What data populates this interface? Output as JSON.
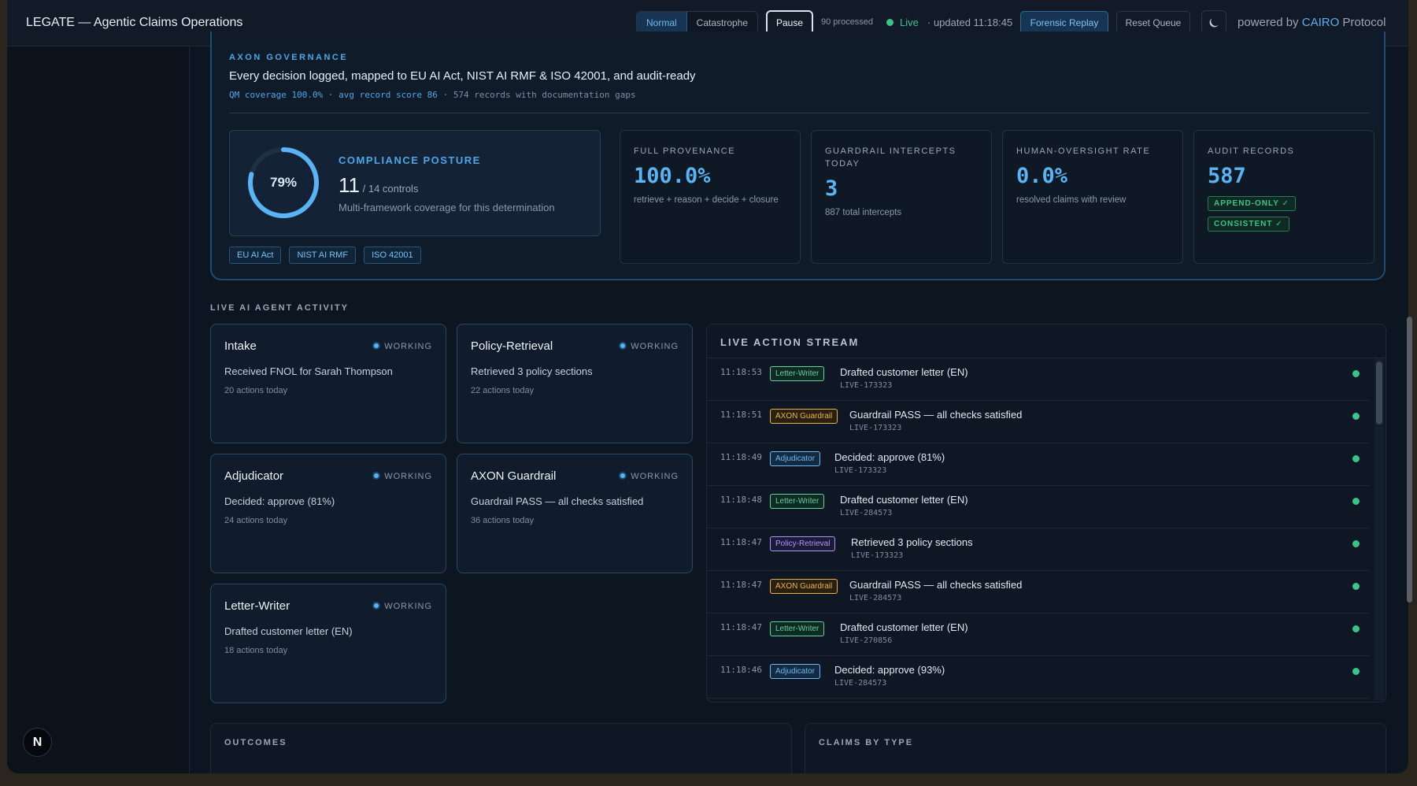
{
  "header": {
    "title": "LEGATE — Agentic Claims Operations",
    "modes": [
      "Normal",
      "Catastrophe"
    ],
    "active_mode": "Normal",
    "pause_label": "Pause",
    "processed": "90 processed",
    "live_label": "Live",
    "updated": "· updated 11:18:45",
    "forensic_label": "Forensic Replay",
    "reset_label": "Reset Queue",
    "powered_prefix": "powered by",
    "powered_brand": "CAIRO",
    "powered_suffix": "Protocol"
  },
  "governance": {
    "eyebrow": "AXON GOVERNANCE",
    "headline": "Every decision logged, mapped to EU AI Act, NIST AI RMF & ISO 42001, and audit-ready",
    "qm_coverage": "QM coverage 100.0%",
    "avg_score": "avg record score 86",
    "gaps": "574 records with documentation gaps",
    "posture": {
      "percent_label": "79%",
      "percent_value": 79,
      "title": "COMPLIANCE POSTURE",
      "controls_met": "11",
      "controls_total": "/ 14 controls",
      "description": "Multi-framework coverage for this determination"
    },
    "frameworks": [
      "EU AI Act",
      "NIST AI RMF",
      "ISO 42001"
    ],
    "metrics": [
      {
        "label": "FULL PROVENANCE",
        "value": "100.0%",
        "sub": "retrieve + reason + decide + closure"
      },
      {
        "label": "GUARDRAIL INTERCEPTS TODAY",
        "value": "3",
        "sub": "887 total intercepts"
      },
      {
        "label": "HUMAN-OVERSIGHT RATE",
        "value": "0.0%",
        "sub": "resolved claims with review"
      },
      {
        "label": "AUDIT RECORDS",
        "value": "587",
        "badges": [
          "APPEND-ONLY ✓",
          "CONSISTENT ✓"
        ]
      }
    ]
  },
  "agents": {
    "section_label": "LIVE AI AGENT ACTIVITY",
    "items": [
      {
        "name": "Intake",
        "status": "WORKING",
        "activity": "Received FNOL for Sarah Thompson",
        "count": "20 actions today"
      },
      {
        "name": "Policy-Retrieval",
        "status": "WORKING",
        "activity": "Retrieved 3 policy sections",
        "count": "22 actions today"
      },
      {
        "name": "Adjudicator",
        "status": "WORKING",
        "activity": "Decided: approve (81%)",
        "count": "24 actions today"
      },
      {
        "name": "AXON Guardrail",
        "status": "WORKING",
        "activity": "Guardrail PASS — all checks satisfied",
        "count": "36 actions today"
      },
      {
        "name": "Letter-Writer",
        "status": "WORKING",
        "activity": "Drafted customer letter (EN)",
        "count": "18 actions today"
      }
    ]
  },
  "stream": {
    "title": "LIVE ACTION STREAM",
    "rows": [
      {
        "time": "11:18:53",
        "agent": "Letter-Writer",
        "message": "Drafted customer letter (EN)",
        "claim": "LIVE-173323"
      },
      {
        "time": "11:18:51",
        "agent": "AXON Guardrail",
        "message": "Guardrail PASS — all checks satisfied",
        "claim": "LIVE-173323"
      },
      {
        "time": "11:18:49",
        "agent": "Adjudicator",
        "message": "Decided: approve (81%)",
        "claim": "LIVE-173323"
      },
      {
        "time": "11:18:48",
        "agent": "Letter-Writer",
        "message": "Drafted customer letter (EN)",
        "claim": "LIVE-284573"
      },
      {
        "time": "11:18:47",
        "agent": "Policy-Retrieval",
        "message": "Retrieved 3 policy sections",
        "claim": "LIVE-173323"
      },
      {
        "time": "11:18:47",
        "agent": "AXON Guardrail",
        "message": "Guardrail PASS — all checks satisfied",
        "claim": "LIVE-284573"
      },
      {
        "time": "11:18:47",
        "agent": "Letter-Writer",
        "message": "Drafted customer letter (EN)",
        "claim": "LIVE-270856"
      },
      {
        "time": "11:18:46",
        "agent": "Adjudicator",
        "message": "Decided: approve (93%)",
        "claim": "LIVE-284573"
      }
    ]
  },
  "bottom": {
    "outcomes_label": "OUTCOMES",
    "claims_label": "CLAIMS BY TYPE"
  },
  "sidebar": {
    "badge_letter": "N"
  },
  "colors": {
    "accent": "#5ab4f4",
    "live": "#3ac48a",
    "background": "#0d1520"
  },
  "icons": {
    "theme_toggle": "moon-icon",
    "status_ok": "status-dot-icon"
  }
}
